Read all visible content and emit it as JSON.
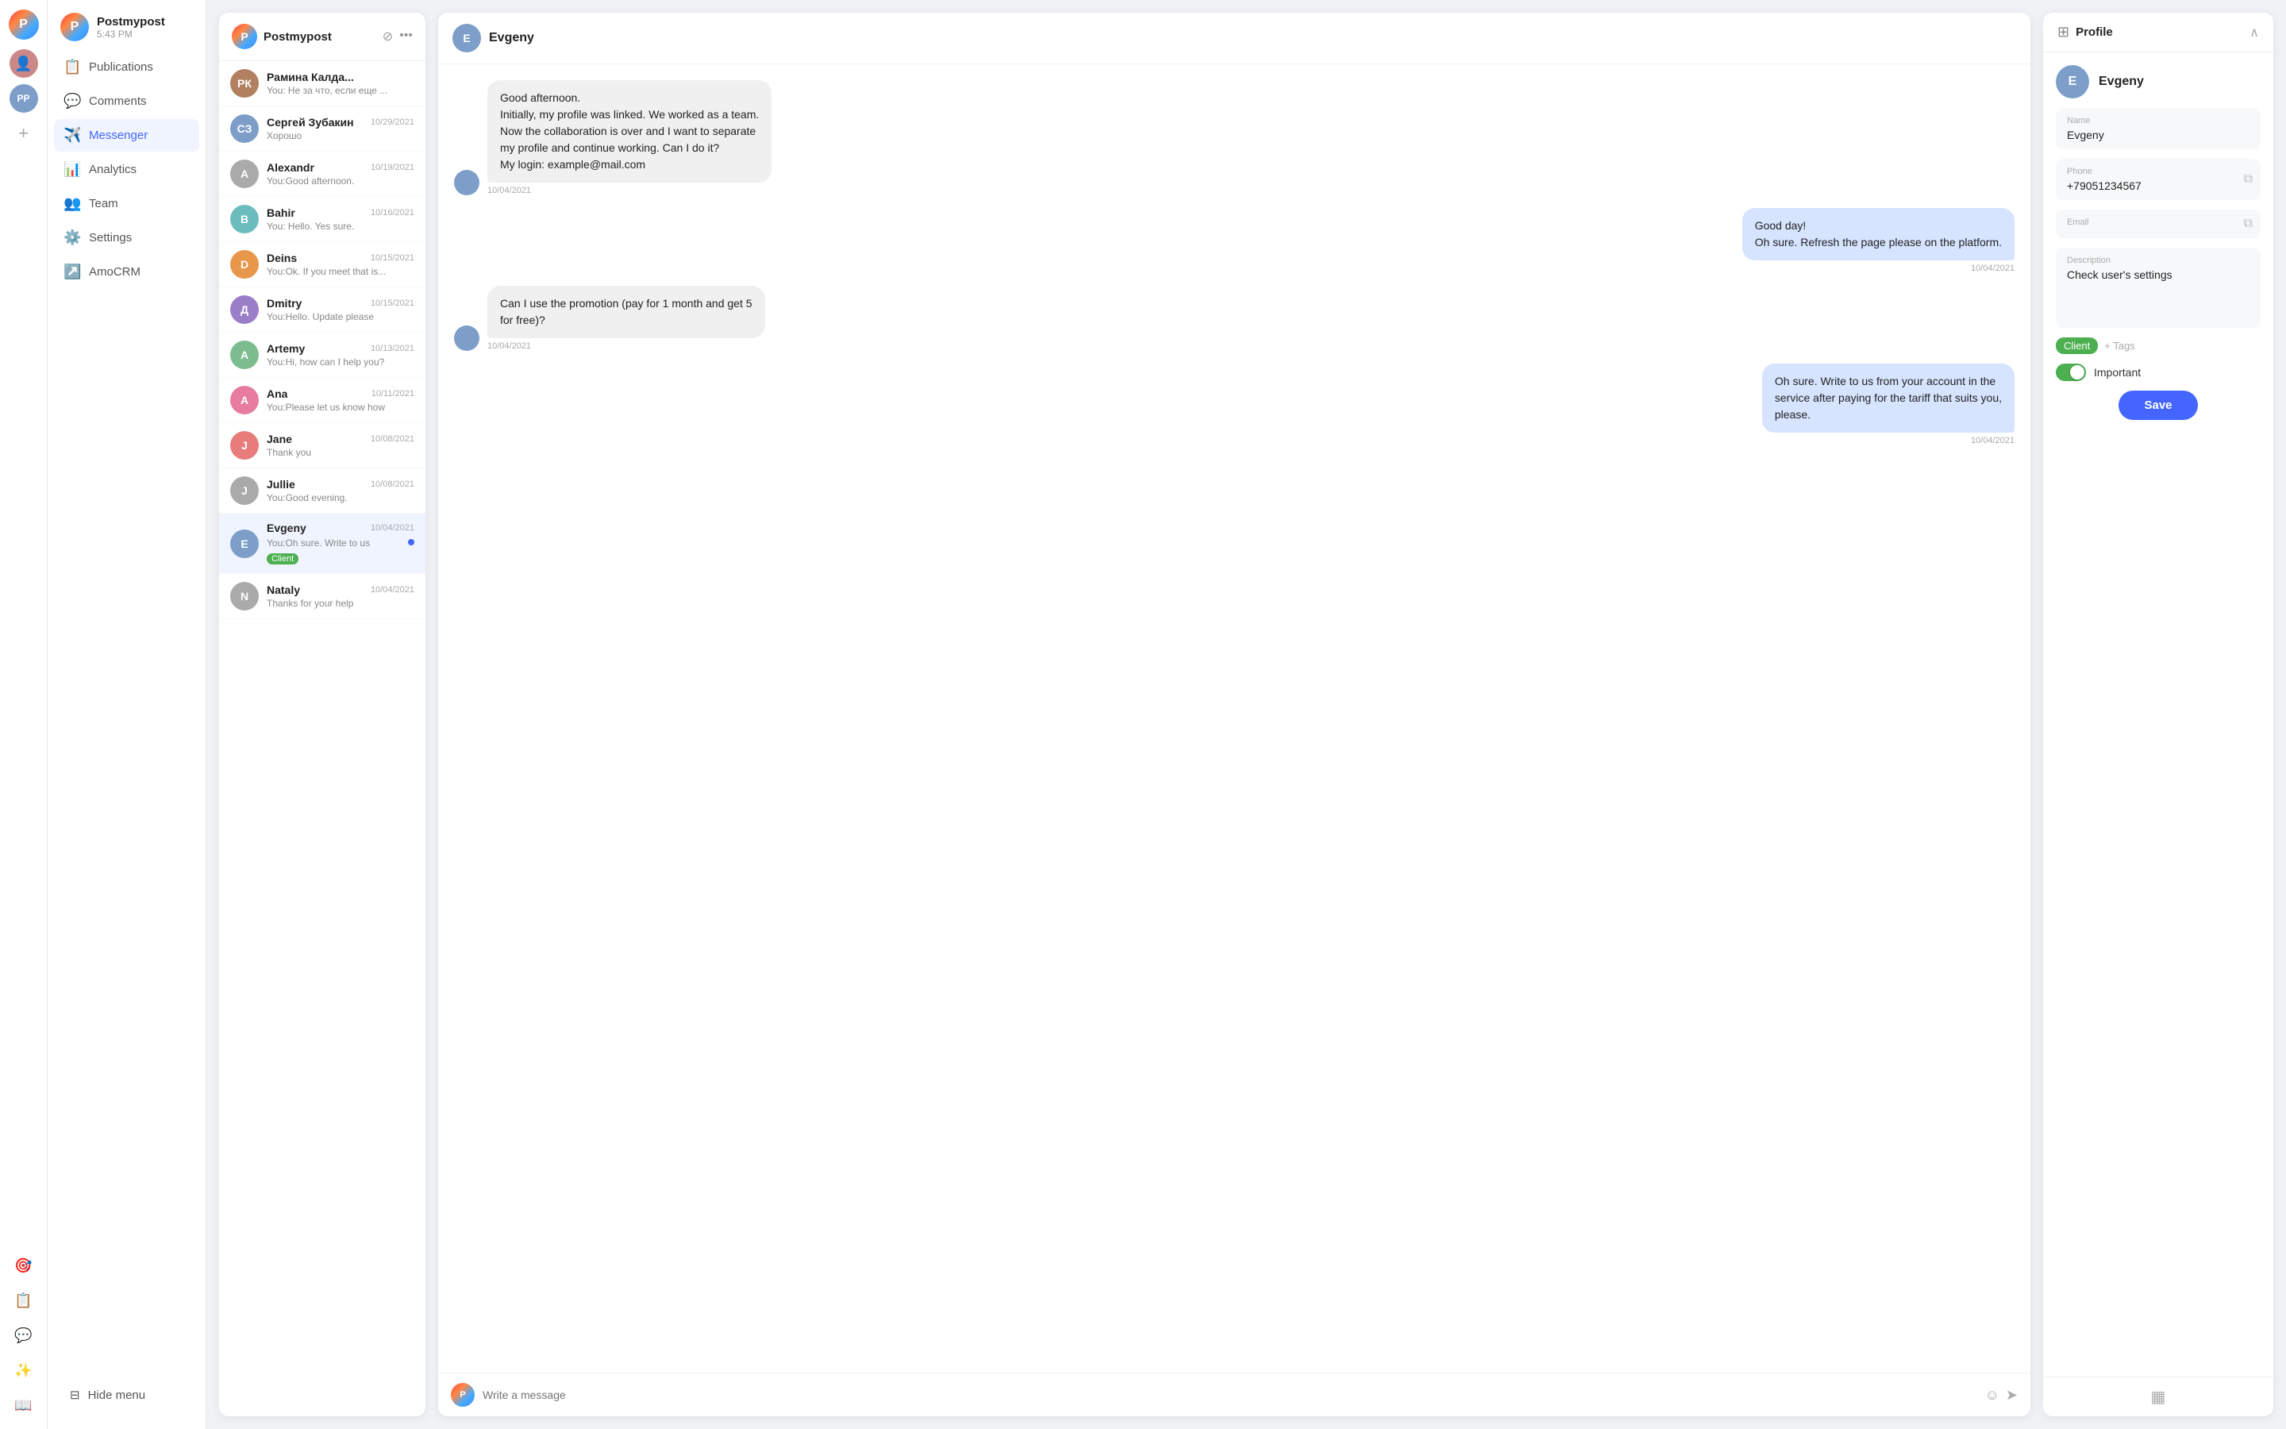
{
  "app": {
    "name": "Postmypost",
    "time": "5:43 PM"
  },
  "iconBar": {
    "userAvatarLabel": "User Avatar",
    "ppLabel": "PP"
  },
  "sidebar": {
    "logo": "P",
    "title": "Postmypost",
    "time": "5:43 PM",
    "navItems": [
      {
        "id": "publications",
        "label": "Publications",
        "icon": "📋"
      },
      {
        "id": "comments",
        "label": "Comments",
        "icon": "💬"
      },
      {
        "id": "messenger",
        "label": "Messenger",
        "icon": "✈️",
        "active": true
      },
      {
        "id": "analytics",
        "label": "Analytics",
        "icon": "📊"
      },
      {
        "id": "team",
        "label": "Team",
        "icon": "👥"
      },
      {
        "id": "settings",
        "label": "Settings",
        "icon": "⚙️"
      },
      {
        "id": "amocrm",
        "label": "AmoCRM",
        "icon": "↗️"
      }
    ],
    "hideMenu": "Hide menu"
  },
  "chatList": {
    "platform": "Postmypost",
    "items": [
      {
        "id": 1,
        "name": "Рамина Калда...",
        "preview": "You: Не за что, если еще ...",
        "date": "",
        "avatarColor": "av-brown",
        "initials": "РК"
      },
      {
        "id": 2,
        "name": "Сергей Зубакин",
        "preview": "Хорошо",
        "date": "10/29/2021",
        "avatarColor": "av-blue",
        "initials": "СЗ"
      },
      {
        "id": 3,
        "name": "Alexandr",
        "preview": "You:Good afternoon.",
        "date": "10/19/2021",
        "avatarColor": "av-gray",
        "initials": "A"
      },
      {
        "id": 4,
        "name": "Bahir",
        "preview": "You: Hello. Yes sure.",
        "date": "10/16/2021",
        "avatarColor": "av-teal",
        "initials": "B"
      },
      {
        "id": 5,
        "name": "Deins",
        "preview": "You:Ok. If you meet that is...",
        "date": "10/15/2021",
        "avatarColor": "av-orange",
        "initials": "D"
      },
      {
        "id": 6,
        "name": "Dmitry",
        "preview": "You:Hello. Update please",
        "date": "10/15/2021",
        "avatarColor": "av-purple",
        "initials": "Д"
      },
      {
        "id": 7,
        "name": "Artemy",
        "preview": "You:Hi, how can I help you?",
        "date": "10/13/2021",
        "avatarColor": "av-green",
        "initials": "A"
      },
      {
        "id": 8,
        "name": "Ana",
        "preview": "You:Please let us know how",
        "date": "10/11/2021",
        "avatarColor": "av-pink",
        "initials": "A"
      },
      {
        "id": 9,
        "name": "Jane",
        "preview": "Thank you",
        "date": "10/08/2021",
        "avatarColor": "av-red",
        "initials": "J"
      },
      {
        "id": 10,
        "name": "Jullie",
        "preview": "You:Good evening.",
        "date": "10/08/2021",
        "avatarColor": "av-gray",
        "initials": "J"
      },
      {
        "id": 11,
        "name": "Evgeny",
        "preview": "You:Oh sure. Write to us",
        "date": "10/04/2021",
        "avatarColor": "av-blue",
        "initials": "E",
        "active": true,
        "hasDot": true,
        "tag": "Client"
      },
      {
        "id": 12,
        "name": "Nataly",
        "preview": "Thanks for your help",
        "date": "10/04/2021",
        "avatarColor": "av-gray",
        "initials": "N"
      }
    ]
  },
  "chat": {
    "contactName": "Evgeny",
    "messages": [
      {
        "id": 1,
        "type": "received",
        "text": "Good afternoon.\nInitially, my profile was linked. We worked as a team.\nNow the collaboration is over and I want to separate\nmy profile and continue working. Can I do it?\nMy login: example@mail.com",
        "time": "10/04/2021"
      },
      {
        "id": 2,
        "type": "sent",
        "text": "Good day!\nOh sure. Refresh the page please on the platform.",
        "time": "10/04/2021"
      },
      {
        "id": 3,
        "type": "received",
        "text": "Can I use the promotion (pay for 1 month and get 5\nfor free)?",
        "time": "10/04/2021"
      },
      {
        "id": 4,
        "type": "sent",
        "text": "Oh sure. Write to us from your account in the\nservice after paying for the tariff that suits you,\nplease.",
        "time": "10/04/2021"
      }
    ],
    "inputPlaceholder": "Write a message"
  },
  "profile": {
    "title": "Profile",
    "name": "Evgeny",
    "fields": {
      "nameLabel": "Name",
      "nameValue": "Evgeny",
      "phoneLabel": "Phone",
      "phoneValue": "+79051234567",
      "emailLabel": "Email",
      "emailValue": "",
      "descriptionLabel": "Description",
      "descriptionValue": "Check user's settings"
    },
    "tags": [
      "Client"
    ],
    "addTagLabel": "+ Tags",
    "importantLabel": "Important",
    "saveLabel": "Save"
  },
  "icons": {
    "filter": "⊘",
    "more": "···",
    "chevronUp": "∧",
    "copy": "⧉",
    "emoji": "☺",
    "send": "➤",
    "grid": "▦",
    "plus": "+"
  }
}
